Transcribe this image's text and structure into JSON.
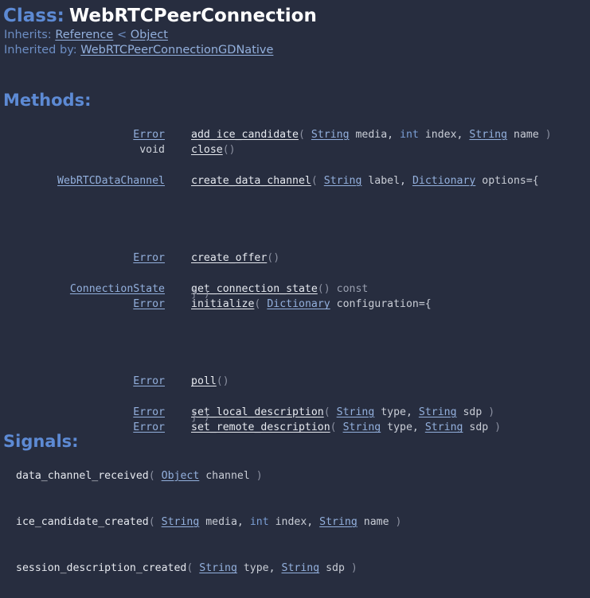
{
  "header": {
    "class_label": "Class:",
    "class_name": "WebRTCPeerConnection",
    "inherits_label": "Inherits:",
    "inherits_parent": "Reference",
    "inherits_separator": "<",
    "inherits_grandparent": "Object",
    "inherited_by_label": "Inherited by:",
    "inherited_by_value": "WebRTCPeerConnectionGDNative"
  },
  "sections": {
    "methods_heading": "Methods:",
    "signals_heading": "Signals:"
  },
  "methods": [
    {
      "return_type": "Error",
      "return_is_link": true,
      "name": "add_ice_candidate",
      "tokens": [
        {
          "text": "(",
          "kind": "punct"
        },
        {
          "text": " ",
          "kind": "plain"
        },
        {
          "text": "String",
          "kind": "type"
        },
        {
          "text": " media,",
          "kind": "arg"
        },
        {
          "text": " ",
          "kind": "plain"
        },
        {
          "text": "int",
          "kind": "prim"
        },
        {
          "text": " index,",
          "kind": "arg"
        },
        {
          "text": " ",
          "kind": "plain"
        },
        {
          "text": "String",
          "kind": "type"
        },
        {
          "text": " name",
          "kind": "arg"
        },
        {
          "text": " )",
          "kind": "punct"
        }
      ]
    },
    {
      "return_type": "void",
      "return_is_link": false,
      "name": "close",
      "tokens": [
        {
          "text": "()",
          "kind": "punct"
        }
      ]
    },
    {
      "spacer": true
    },
    {
      "return_type": "WebRTCDataChannel",
      "return_is_link": true,
      "name": "create_data_channel",
      "tokens": [
        {
          "text": "(",
          "kind": "punct"
        },
        {
          "text": " ",
          "kind": "plain"
        },
        {
          "text": "String",
          "kind": "type"
        },
        {
          "text": " label,",
          "kind": "arg"
        },
        {
          "text": " ",
          "kind": "plain"
        },
        {
          "text": "Dictionary",
          "kind": "type"
        },
        {
          "text": " options={",
          "kind": "arg"
        }
      ]
    },
    {
      "spacer": true
    },
    {
      "spacer": true
    },
    {
      "spacer": true
    },
    {
      "spacer": true
    },
    {
      "return_type": "Error",
      "return_is_link": true,
      "name": "create_offer",
      "tokens": [
        {
          "text": "()",
          "kind": "punct"
        }
      ]
    },
    {
      "spacer": true
    },
    {
      "return_type": "ConnectionState",
      "return_is_link": true,
      "name": "get_connection_state",
      "overlap_text": "} )",
      "tokens": [
        {
          "text": "()",
          "kind": "punct"
        },
        {
          "text": " const",
          "kind": "const"
        }
      ]
    },
    {
      "return_type": "Error",
      "return_is_link": true,
      "name": "initialize",
      "tokens": [
        {
          "text": "(",
          "kind": "punct"
        },
        {
          "text": " ",
          "kind": "plain"
        },
        {
          "text": "Dictionary",
          "kind": "type"
        },
        {
          "text": " configuration={",
          "kind": "arg"
        }
      ]
    },
    {
      "spacer": true
    },
    {
      "spacer": true
    },
    {
      "spacer": true
    },
    {
      "spacer": true
    },
    {
      "return_type": "Error",
      "return_is_link": true,
      "name": "poll",
      "tokens": [
        {
          "text": "()",
          "kind": "punct"
        }
      ]
    },
    {
      "spacer": true
    },
    {
      "return_type": "Error",
      "return_is_link": true,
      "name": "set_local_description",
      "overlap_text": "} )",
      "tokens": [
        {
          "text": "(",
          "kind": "punct"
        },
        {
          "text": " ",
          "kind": "plain"
        },
        {
          "text": "String",
          "kind": "type"
        },
        {
          "text": " type,",
          "kind": "arg"
        },
        {
          "text": " ",
          "kind": "plain"
        },
        {
          "text": "String",
          "kind": "type"
        },
        {
          "text": " sdp",
          "kind": "arg"
        },
        {
          "text": " )",
          "kind": "punct"
        }
      ]
    },
    {
      "return_type": "Error",
      "return_is_link": true,
      "name": "set_remote_description",
      "tokens": [
        {
          "text": "(",
          "kind": "punct"
        },
        {
          "text": " ",
          "kind": "plain"
        },
        {
          "text": "String",
          "kind": "type"
        },
        {
          "text": " type,",
          "kind": "arg"
        },
        {
          "text": " ",
          "kind": "plain"
        },
        {
          "text": "String",
          "kind": "type"
        },
        {
          "text": " sdp",
          "kind": "arg"
        },
        {
          "text": " )",
          "kind": "punct"
        }
      ]
    }
  ],
  "signals": [
    {
      "name": "data_channel_received",
      "tokens": [
        {
          "text": "(",
          "kind": "punct"
        },
        {
          "text": " ",
          "kind": "plain"
        },
        {
          "text": "Object",
          "kind": "type"
        },
        {
          "text": " channel",
          "kind": "arg"
        },
        {
          "text": " )",
          "kind": "punct"
        }
      ]
    },
    {
      "spacer": true
    },
    {
      "spacer": true
    },
    {
      "name": "ice_candidate_created",
      "tokens": [
        {
          "text": "(",
          "kind": "punct"
        },
        {
          "text": " ",
          "kind": "plain"
        },
        {
          "text": "String",
          "kind": "type"
        },
        {
          "text": " media,",
          "kind": "arg"
        },
        {
          "text": " ",
          "kind": "plain"
        },
        {
          "text": "int",
          "kind": "prim"
        },
        {
          "text": " index,",
          "kind": "arg"
        },
        {
          "text": " ",
          "kind": "plain"
        },
        {
          "text": "String",
          "kind": "type"
        },
        {
          "text": " name",
          "kind": "arg"
        },
        {
          "text": " )",
          "kind": "punct"
        }
      ]
    },
    {
      "spacer": true
    },
    {
      "spacer": true
    },
    {
      "name": "session_description_created",
      "tokens": [
        {
          "text": "(",
          "kind": "punct"
        },
        {
          "text": " ",
          "kind": "plain"
        },
        {
          "text": "String",
          "kind": "type"
        },
        {
          "text": " type,",
          "kind": "arg"
        },
        {
          "text": " ",
          "kind": "plain"
        },
        {
          "text": "String",
          "kind": "type"
        },
        {
          "text": " sdp",
          "kind": "arg"
        },
        {
          "text": " )",
          "kind": "punct"
        }
      ]
    }
  ],
  "colors": {
    "background": "#272d3f",
    "heading_blue": "#5d8ad4",
    "link_blue": "#93b0dd",
    "class_name_white": "#ffffff",
    "arg_text": "#c9cdd6",
    "punct_gray": "#8b90a0"
  }
}
